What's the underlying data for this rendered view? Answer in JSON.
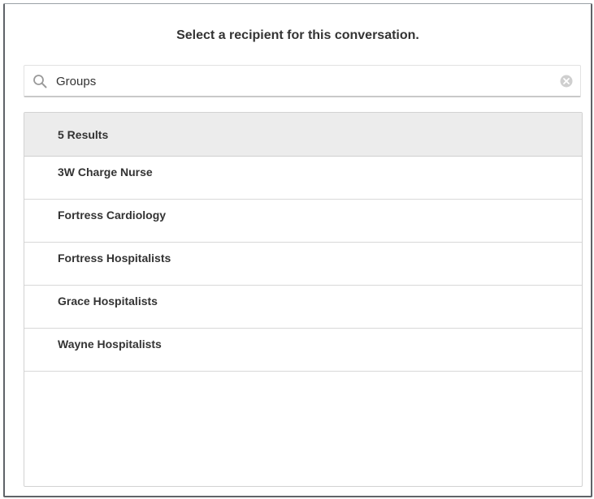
{
  "dialog": {
    "title": "Select a recipient for this conversation."
  },
  "search": {
    "value": "Groups",
    "icon": "search-icon",
    "clear_icon": "clear-icon"
  },
  "results": {
    "count_label": "5 Results",
    "items": [
      {
        "label": "3W Charge Nurse"
      },
      {
        "label": "Fortress Cardiology"
      },
      {
        "label": "Fortress Hospitalists"
      },
      {
        "label": "Grace Hospitalists"
      },
      {
        "label": "Wayne Hospitalists"
      }
    ]
  }
}
